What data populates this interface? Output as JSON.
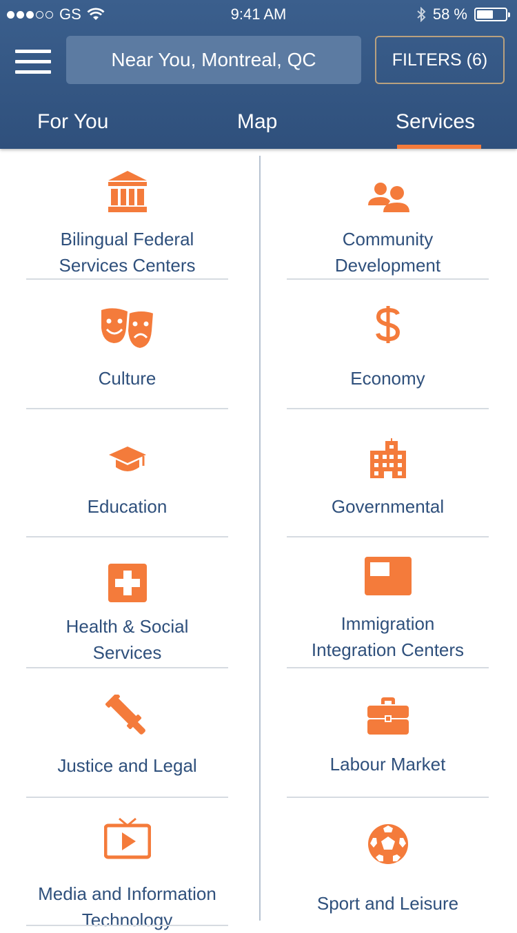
{
  "status_bar": {
    "carrier": "GS",
    "time": "9:41 AM",
    "battery": "58 %",
    "signal_bars": 3,
    "battery_level": 0.58
  },
  "header": {
    "location": "Near You, Montreal, QC",
    "filters_label": "FILTERS (6)"
  },
  "tabs": [
    {
      "label": "For You"
    },
    {
      "label": "Map"
    },
    {
      "label": "Services",
      "active": true
    }
  ],
  "accent_color": "#f47b3b",
  "header_color": "#2f507c",
  "services": [
    {
      "label_lines": [
        "Bilingual Federal",
        "Services Centers"
      ],
      "icon": "bank-icon"
    },
    {
      "label_lines": [
        "Community",
        "Development"
      ],
      "icon": "users-icon"
    },
    {
      "label_lines": [
        "Culture"
      ],
      "icon": "theater-masks-icon"
    },
    {
      "label_lines": [
        "Economy"
      ],
      "icon": "dollar-icon"
    },
    {
      "label_lines": [
        "Education"
      ],
      "icon": "graduation-cap-icon"
    },
    {
      "label_lines": [
        "Governmental"
      ],
      "icon": "building-icon"
    },
    {
      "label_lines": [
        "Health & Social",
        "Services"
      ],
      "icon": "medical-cross-icon"
    },
    {
      "label_lines": [
        "Immigration",
        "Integration Centers"
      ],
      "icon": "flag-icon"
    },
    {
      "label_lines": [
        "Justice and Legal"
      ],
      "icon": "gavel-icon"
    },
    {
      "label_lines": [
        "Labour Market"
      ],
      "icon": "briefcase-icon"
    },
    {
      "label_lines": [
        "Media and Information",
        "Technology"
      ],
      "icon": "tv-icon"
    },
    {
      "label_lines": [
        "Sport and Leisure"
      ],
      "icon": "soccer-ball-icon"
    }
  ]
}
